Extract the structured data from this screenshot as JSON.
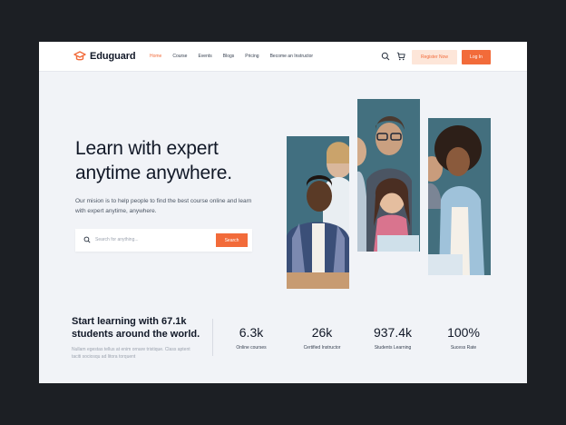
{
  "brand": {
    "name": "Eduguard",
    "accent": "#f26b3a"
  },
  "nav": {
    "items": [
      {
        "label": "Home",
        "active": true
      },
      {
        "label": "Course",
        "active": false
      },
      {
        "label": "Events",
        "active": false
      },
      {
        "label": "Blogs",
        "active": false
      },
      {
        "label": "Pricing",
        "active": false
      },
      {
        "label": "Become an Instructor",
        "active": false
      }
    ],
    "icons": [
      "search-icon",
      "cart-icon"
    ],
    "register_label": "Register Now",
    "login_label": "Log In"
  },
  "hero": {
    "title": "Learn with expert anytime anywhere.",
    "subtitle": "Our mision is to help people to find the best course online and learn with expert anytime, anywhere.",
    "search": {
      "placeholder": "Search for anything...",
      "button_label": "Search"
    }
  },
  "stats_section": {
    "title": "Start learning with 67.1k students around the world.",
    "text": "Nullam egestas tellus at enim ornare tristique. Class aptent taciti sociosqu ad litora torquent",
    "items": [
      {
        "value": "6.3k",
        "label": "Online courses"
      },
      {
        "value": "26k",
        "label": "Certified Instructor"
      },
      {
        "value": "937.4k",
        "label": "Students Learning"
      },
      {
        "value": "100%",
        "label": "Sucess Rate"
      }
    ]
  }
}
